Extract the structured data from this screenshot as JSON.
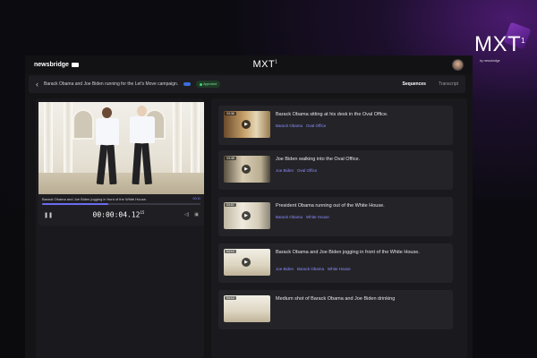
{
  "app": {
    "brand": "newsbridge",
    "center_logo": "MXT",
    "center_logo_sup": "1"
  },
  "subbar": {
    "back": "‹",
    "title": "Barack Obama and Joe Biden running for the Let's Move campaign.",
    "tag_blue": "",
    "tag_green": "Approved",
    "tabs": [
      "Sequences",
      "Transcript"
    ]
  },
  "player": {
    "caption": "Barack Obama and Joe Biden jogging in front of the White House.",
    "timecode_right": "00:11",
    "timecode": "00:00:04.12",
    "timecode_suffix": "15",
    "progress": 0.42
  },
  "sequences": [
    {
      "tc": "03:36",
      "title": "Barack Obama sitting at his desk in the Oval Office.",
      "tags": [
        "Barack Obama",
        "Oval Office"
      ]
    },
    {
      "tc": "03:48",
      "title": "Joe Biden walking into the Oval Office.",
      "tags": [
        "Joe Biden",
        "Oval Office"
      ]
    },
    {
      "tc": "03:57",
      "title": "President Obama running out of the White House.",
      "tags": [
        "Barack Obama",
        "White House"
      ]
    },
    {
      "tc": "04:12",
      "title": "Barack Obama and Joe Biden jogging in front of the White House.",
      "tags": [
        "Joe Biden",
        "Barack Obama",
        "White House"
      ]
    },
    {
      "tc": "04:12",
      "title": "Medium shot of Barack Obama and Joe Biden drinking",
      "tags": []
    }
  ],
  "corner_logo": {
    "text": "MXT",
    "sup": "1",
    "by": "by newsbridge"
  },
  "colors": {
    "accent": "#6b6bf0",
    "tag_link": "#8c8cff",
    "approved": "#3ddc6b"
  }
}
